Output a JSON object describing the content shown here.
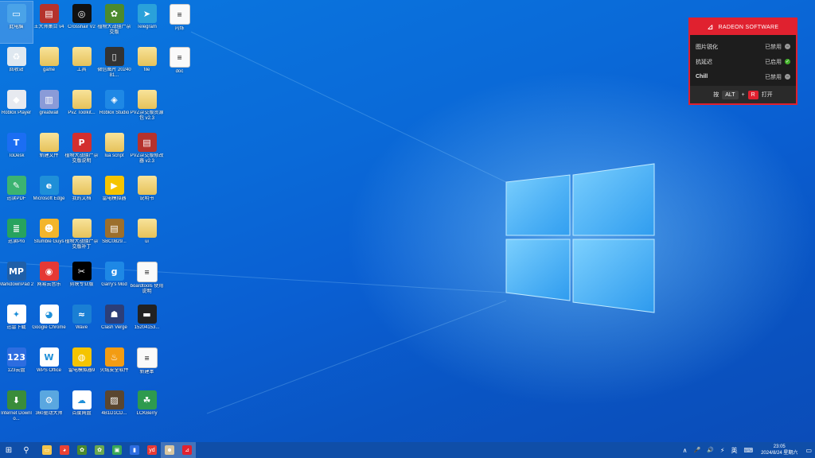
{
  "desktop": {
    "icons": [
      {
        "label": "此电脑",
        "icon": "computer-icon",
        "color": "#4aa3e8",
        "glyph": "▭"
      },
      {
        "label": "王大师集合 v4",
        "icon": "winrar-icon",
        "color": "#b5322c",
        "glyph": "▤"
      },
      {
        "label": "Crosshair V2",
        "icon": "crosshair-icon",
        "color": "#111111",
        "glyph": "◎"
      },
      {
        "label": "植物大战僵尸杂交版",
        "icon": "plants-game-icon",
        "color": "#4b8a2e",
        "glyph": "✿"
      },
      {
        "label": "Telegram",
        "icon": "telegram-icon",
        "color": "#2aa1da",
        "glyph": "➤"
      },
      {
        "label": "闪烁",
        "icon": "text-file-icon",
        "color": "#ffffff",
        "glyph": "≡"
      },
      {
        "label": "回收站",
        "icon": "recycle-bin-icon",
        "color": "#dfe8f0",
        "glyph": "♻"
      },
      {
        "label": "game",
        "icon": "folder-icon",
        "color": "#e8c35c",
        "glyph": ""
      },
      {
        "label": "工具",
        "icon": "folder-icon",
        "color": "#e8c35c",
        "glyph": ""
      },
      {
        "label": "微信图片 2024081...",
        "icon": "image-file-icon",
        "color": "#333333",
        "glyph": "▯"
      },
      {
        "label": "file",
        "icon": "folder-icon",
        "color": "#e8c35c",
        "glyph": ""
      },
      {
        "label": "doc",
        "icon": "text-file-icon",
        "color": "#ffffff",
        "glyph": "≡"
      },
      {
        "label": "Roblox Player",
        "icon": "roblox-icon",
        "color": "#e7eaf0",
        "glyph": "◆"
      },
      {
        "label": "greatwall",
        "icon": "archive-icon",
        "color": "#8a9bd8",
        "glyph": "▥"
      },
      {
        "label": "PvZ Toolkit...",
        "icon": "folder-icon",
        "color": "#e8c35c",
        "glyph": ""
      },
      {
        "label": "Roblox Studio",
        "icon": "roblox-studio-icon",
        "color": "#1e88e5",
        "glyph": "◈"
      },
      {
        "label": "PVZ杂交版资源包 v2.3",
        "icon": "folder-icon",
        "color": "#e8c35c",
        "glyph": ""
      },
      {
        "label": "ToDesk",
        "icon": "todesk-icon",
        "color": "#1b6ef3",
        "glyph": "T"
      },
      {
        "label": "新建文件",
        "icon": "folder-icon",
        "color": "#e8c35c",
        "glyph": ""
      },
      {
        "label": "植物大战僵尸杂交版说明",
        "icon": "pdf-icon",
        "color": "#d32f2f",
        "glyph": "P"
      },
      {
        "label": "lua script",
        "icon": "folder-icon",
        "color": "#e8c35c",
        "glyph": ""
      },
      {
        "label": "PVZ杂交版修改器 v2.3",
        "icon": "winrar-icon",
        "color": "#b5322c",
        "glyph": "▤"
      },
      {
        "label": "迅读PDF",
        "icon": "green-app-icon",
        "color": "#3cb371",
        "glyph": "✎"
      },
      {
        "label": "Microsoft Edge",
        "icon": "edge-icon",
        "color": "#1f8fd8",
        "glyph": "e"
      },
      {
        "label": "我的文档",
        "icon": "folder-icon",
        "color": "#e8c35c",
        "glyph": ""
      },
      {
        "label": "雷电模拟器",
        "icon": "ldplayer-icon",
        "color": "#f5c400",
        "glyph": "▶"
      },
      {
        "label": "说明书",
        "icon": "folder-icon",
        "color": "#e8c35c",
        "glyph": ""
      },
      {
        "label": "迅读Pro",
        "icon": "green-app-icon",
        "color": "#27a35e",
        "glyph": "≣"
      },
      {
        "label": "Stumble Guys",
        "icon": "stumble-guys-icon",
        "color": "#f3b52b",
        "glyph": "☻"
      },
      {
        "label": "植物大战僵尸杂交版补丁",
        "icon": "folder-icon",
        "color": "#e8c35c",
        "glyph": ""
      },
      {
        "label": "SBC0829...",
        "icon": "winrar-icon",
        "color": "#9c6f2c",
        "glyph": "▤"
      },
      {
        "label": "ui",
        "icon": "folder-icon",
        "color": "#e8c35c",
        "glyph": ""
      },
      {
        "label": "MarkdownPad 2",
        "icon": "markdownpad-icon",
        "color": "#1f5fa8",
        "glyph": "MP"
      },
      {
        "label": "网易云音乐",
        "icon": "netease-music-icon",
        "color": "#e53935",
        "glyph": "◉"
      },
      {
        "label": "剪映专业版",
        "icon": "capcut-icon",
        "color": "#000000",
        "glyph": "✂"
      },
      {
        "label": "Garry's Mod",
        "icon": "garrys-mod-icon",
        "color": "#1e88e5",
        "glyph": "g"
      },
      {
        "label": "boardtools 使用说明",
        "icon": "text-file-icon",
        "color": "#ffffff",
        "glyph": "≡"
      },
      {
        "label": "迅雷下载",
        "icon": "thunder-icon",
        "color": "#ffffff",
        "glyph": "✦"
      },
      {
        "label": "Google Chrome",
        "icon": "chrome-icon",
        "color": "#ffffff",
        "glyph": "◕"
      },
      {
        "label": "Wave",
        "icon": "wave-icon",
        "color": "#1a7fd4",
        "glyph": "≈"
      },
      {
        "label": "Clash Verge",
        "icon": "clash-verge-icon",
        "color": "#2c3e78",
        "glyph": "☗"
      },
      {
        "label": "15204153...",
        "icon": "video-file-icon",
        "color": "#222222",
        "glyph": "▬"
      },
      {
        "label": "123云盘",
        "icon": "pan123-icon",
        "color": "#2d6de0",
        "glyph": "123"
      },
      {
        "label": "WPS Office",
        "icon": "wps-icon",
        "color": "#ffffff",
        "glyph": "W"
      },
      {
        "label": "雷电模拟器9",
        "icon": "ldplayer9-icon",
        "color": "#f5c400",
        "glyph": "◍"
      },
      {
        "label": "火绒安全软件",
        "icon": "huorong-icon",
        "color": "#f39c12",
        "glyph": "♨"
      },
      {
        "label": "新建本",
        "icon": "text-file-icon",
        "color": "#ffffff",
        "glyph": "≡"
      },
      {
        "label": "Internet Downlo...",
        "icon": "idm-icon",
        "color": "#3a8c3a",
        "glyph": "⬇"
      },
      {
        "label": "360驱动大师",
        "icon": "driver-master-icon",
        "color": "#5aa7e0",
        "glyph": "⚙"
      },
      {
        "label": "百度网盘",
        "icon": "baidu-netdisk-icon",
        "color": "#ffffff",
        "glyph": "☁"
      },
      {
        "label": "4B1D1CD...",
        "icon": "image-file-icon",
        "color": "#5a4630",
        "glyph": "▨"
      },
      {
        "label": "LCKBerry",
        "icon": "lck-icon",
        "color": "#2e9a4e",
        "glyph": "☘"
      }
    ]
  },
  "radeon": {
    "title": "RADEON SOFTWARE",
    "logo": "⊿",
    "rows": [
      {
        "name": "图片锐化",
        "state": "已禁用",
        "status": "off"
      },
      {
        "name": "抗延迟",
        "state": "已启用",
        "status": "on"
      },
      {
        "name": "Chill",
        "state": "已禁用",
        "status": "off"
      }
    ],
    "footer": {
      "press": "按",
      "key1": "ALT",
      "plus": "+",
      "key2": "R",
      "open": "打开"
    }
  },
  "taskbar": {
    "start_glyph": "⊞",
    "search_glyph": "⚲",
    "apps": [
      {
        "name": "file-explorer",
        "glyph": "▭",
        "color": "#f3c54d"
      },
      {
        "name": "chrome",
        "glyph": "◕",
        "color": "#e94235"
      },
      {
        "name": "pvz-game",
        "glyph": "✿",
        "color": "#4b8a2e"
      },
      {
        "name": "plants-game",
        "glyph": "✿",
        "color": "#6aa84f"
      },
      {
        "name": "image-viewer",
        "glyph": "▣",
        "color": "#3aa857"
      },
      {
        "name": "stats-app",
        "glyph": "▮",
        "color": "#2d6de0"
      },
      {
        "name": "youdao",
        "glyph": "yd",
        "color": "#e53935"
      },
      {
        "name": "player-app",
        "glyph": "☻",
        "color": "#d9c6a0"
      },
      {
        "name": "radeon",
        "glyph": "⊿",
        "color": "#e0212f"
      }
    ],
    "tray": {
      "chevron": "∧",
      "mic": "🎤",
      "sound": "🔊",
      "network": "⚡",
      "ime": "英",
      "keyboard": "⌨",
      "time": "23:05",
      "date": "2024/8/24 星期六",
      "notify": "▭"
    }
  }
}
